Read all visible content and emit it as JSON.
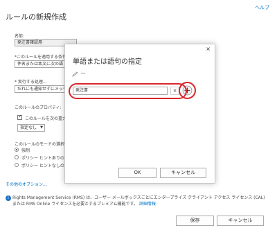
{
  "help_link": "ヘルプ",
  "page_title": "ルールの新規作成",
  "form": {
    "name_label": "名前:",
    "name_value": "発注書確認用",
    "condition_label": "*このルールを適用する条件",
    "condition_value": "件名または本文に次の語",
    "action_label": "* 実行する処理...",
    "action_value": "だれにも通知せずにメッセ",
    "properties_label": "このルールのプロパティ:",
    "audit_label": "このルールを次の重大",
    "severity_value": "指定なし",
    "mode_label": "このルールのモードの選択:",
    "mode_options": [
      {
        "label": "強制",
        "selected": true
      },
      {
        "label": "ポリシー ヒントありのテ",
        "selected": false
      },
      {
        "label": "ポリシー ヒントなしのテ",
        "selected": false
      }
    ],
    "more_options_link": "その他のオプション..."
  },
  "dialog": {
    "title": "単語または語句の指定",
    "close_icon": "×",
    "minus_label": "−",
    "input_value": "発注書",
    "clear_label": "×",
    "add_label": "+",
    "ok_label": "OK",
    "cancel_label": "キャンセル"
  },
  "info": {
    "text": "Rights Management Service (RMS) は、ユーザー メールボックスごとにエンタープライズ クライアント アクセス ライセンス (CAL) または RMS Online ライセンスを必要とするプレミアム機能です。",
    "link": "詳細情報"
  },
  "footer": {
    "save_label": "保存",
    "cancel_label": "キャンセル"
  },
  "colors": {
    "accent": "#0072c6",
    "highlight": "#d9252b"
  }
}
